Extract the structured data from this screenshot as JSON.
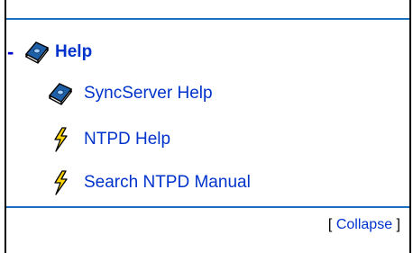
{
  "tree": {
    "toggle_symbol": "-",
    "header_label": "Help",
    "header_icon": "help-book-icon",
    "items": [
      {
        "label": "SyncServer Help",
        "icon": "help-book-icon"
      },
      {
        "label": "NTPD Help",
        "icon": "lightning-bolt-icon"
      },
      {
        "label": "Search NTPD Manual",
        "icon": "lightning-bolt-icon"
      }
    ]
  },
  "footer": {
    "bracket_open": "[",
    "collapse_label": "Collapse",
    "bracket_close": "]"
  },
  "colors": {
    "link": "#0033cc",
    "rule": "#1a6fc0",
    "bolt": "#ffd400",
    "book": "#1f5fa8"
  }
}
